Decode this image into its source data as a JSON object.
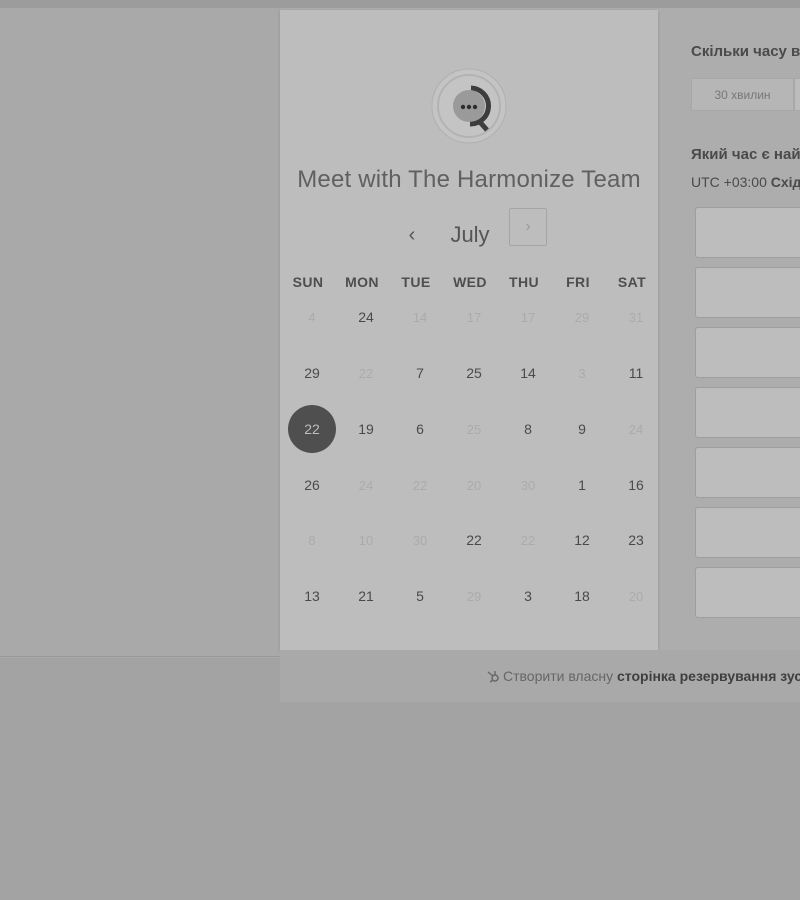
{
  "title": "Meet with The Harmonize Team",
  "calendar": {
    "month": "July",
    "prev_icon": "‹",
    "next_icon": "›",
    "weekdays": [
      "SUN",
      "MON",
      "TUE",
      "WED",
      "THU",
      "FRI",
      "SAT"
    ],
    "weeks": [
      [
        {
          "d": "4",
          "enabled": false
        },
        {
          "d": "24",
          "enabled": true
        },
        {
          "d": "14",
          "enabled": false
        },
        {
          "d": "17",
          "enabled": false
        },
        {
          "d": "17",
          "enabled": false
        },
        {
          "d": "29",
          "enabled": false
        },
        {
          "d": "31",
          "enabled": false
        }
      ],
      [
        {
          "d": "29",
          "enabled": true
        },
        {
          "d": "22",
          "enabled": false
        },
        {
          "d": "7",
          "enabled": true
        },
        {
          "d": "25",
          "enabled": true
        },
        {
          "d": "14",
          "enabled": true
        },
        {
          "d": "3",
          "enabled": false
        },
        {
          "d": "11",
          "enabled": true
        }
      ],
      [
        {
          "d": "22",
          "enabled": true,
          "selected": true
        },
        {
          "d": "19",
          "enabled": true
        },
        {
          "d": "6",
          "enabled": true
        },
        {
          "d": "25",
          "enabled": false
        },
        {
          "d": "8",
          "enabled": true
        },
        {
          "d": "9",
          "enabled": true
        },
        {
          "d": "24",
          "enabled": false
        }
      ],
      [
        {
          "d": "26",
          "enabled": true
        },
        {
          "d": "24",
          "enabled": false
        },
        {
          "d": "22",
          "enabled": false
        },
        {
          "d": "20",
          "enabled": false
        },
        {
          "d": "30",
          "enabled": false
        },
        {
          "d": "1",
          "enabled": true
        },
        {
          "d": "16",
          "enabled": true
        }
      ],
      [
        {
          "d": "8",
          "enabled": false
        },
        {
          "d": "10",
          "enabled": false
        },
        {
          "d": "30",
          "enabled": false
        },
        {
          "d": "22",
          "enabled": true
        },
        {
          "d": "22",
          "enabled": false
        },
        {
          "d": "12",
          "enabled": true
        },
        {
          "d": "23",
          "enabled": true
        }
      ],
      [
        {
          "d": "13",
          "enabled": true
        },
        {
          "d": "21",
          "enabled": true
        },
        {
          "d": "5",
          "enabled": true
        },
        {
          "d": "29",
          "enabled": false
        },
        {
          "d": "3",
          "enabled": true
        },
        {
          "d": "18",
          "enabled": true
        },
        {
          "d": "20",
          "enabled": false
        }
      ]
    ]
  },
  "right": {
    "duration_heading": "Скільки часу в",
    "duration_option": "30 хвилин",
    "time_heading": "Який час є най",
    "tz_offset": "UTC +03:00",
    "tz_name": "Схід"
  },
  "footer": {
    "prefix": "Створити власну",
    "link": "сторінка резервування зустр"
  },
  "colors": {
    "selected_day": "#4f4f4f",
    "panel": "#bdbdbd",
    "backdrop": "#a3a3a3"
  },
  "icons": {
    "logo": "chat-bubble-logo-icon",
    "footer": "hubspot-sprocket-icon"
  }
}
